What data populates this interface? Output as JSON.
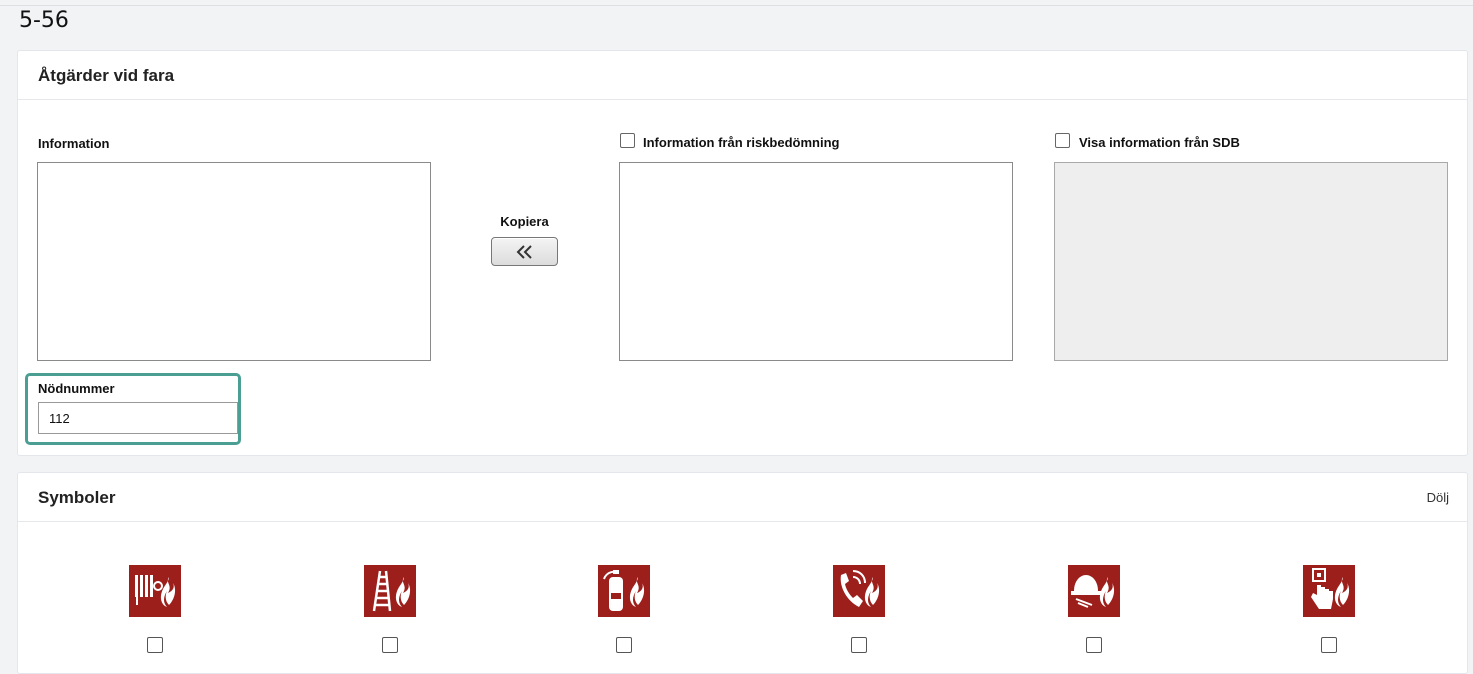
{
  "page": {
    "number": "5-56"
  },
  "hazard_card": {
    "title": "Åtgärder vid fara",
    "information_label": "Information",
    "copy_label": "Kopiera",
    "risk_info_label": "Information från riskbedömning",
    "sdb_info_label": "Visa information från SDB",
    "emergency_label": "Nödnummer",
    "emergency_value": "112"
  },
  "symbols_card": {
    "title": "Symboler",
    "hide_label": "Dölj",
    "symbols": [
      {
        "icon": "fire-hose-reel-icon"
      },
      {
        "icon": "fire-ladder-icon"
      },
      {
        "icon": "fire-extinguisher-icon"
      },
      {
        "icon": "emergency-phone-icon"
      },
      {
        "icon": "fire-alarm-bell-icon"
      },
      {
        "icon": "fire-alarm-call-point-icon"
      }
    ]
  },
  "colors": {
    "accent": "#4a9e92",
    "symbol_red": "#9c1f1c"
  }
}
